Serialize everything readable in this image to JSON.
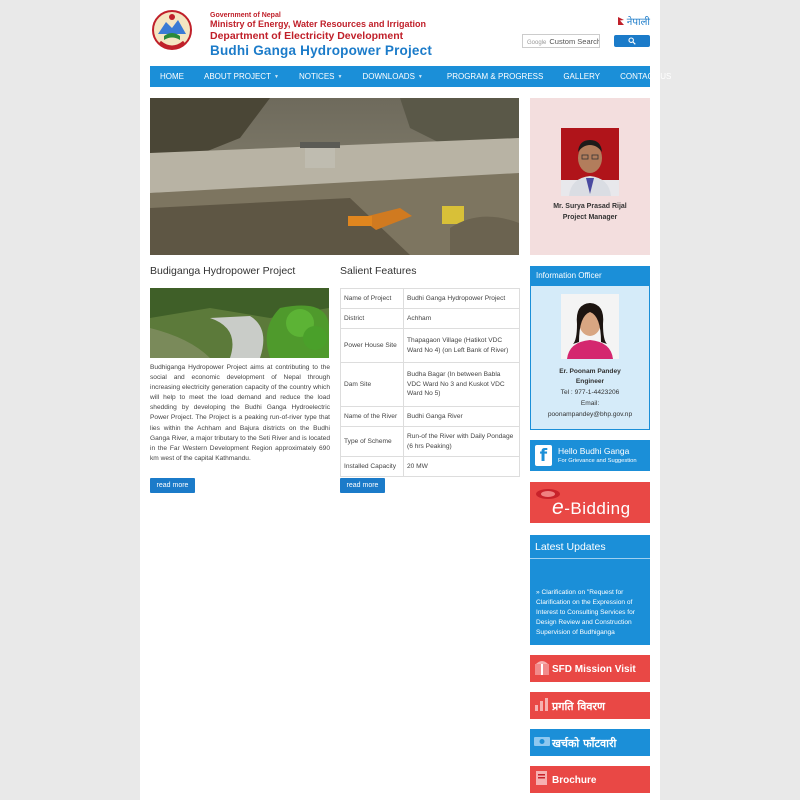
{
  "header": {
    "gov": "Government of Nepal",
    "ministry": "Ministry of Energy, Water Resources and Irrigation",
    "department": "Department of Electricity Development",
    "project": "Budhi Ganga Hydropower Project",
    "language": "नेपाली",
    "search_brand": "Google",
    "search_placeholder": "Custom Search"
  },
  "nav": [
    {
      "label": "HOME",
      "caret": ""
    },
    {
      "label": "ABOUT PROJECT",
      "caret": "▼"
    },
    {
      "label": "NOTICES",
      "caret": "▼"
    },
    {
      "label": "DOWNLOADS",
      "caret": "▼"
    },
    {
      "label": "PROGRAM & PROGRESS",
      "caret": ""
    },
    {
      "label": "GALLERY",
      "caret": ""
    },
    {
      "label": "CONTACT US",
      "caret": ""
    }
  ],
  "manager": {
    "name": "Mr. Surya Prasad Rijal",
    "title": "Project Manager"
  },
  "project": {
    "title": "Budiganga Hydropower Project",
    "description": "Budhiganga Hydropower Project aims at contributing to the social and economic development of Nepal through increasing electricity generation capacity of the country which will help to meet the load demand and reduce the load shedding by developing the Budhi Ganga Hydroelectric Power Project. The Project is a peaking run-of-river type that lies within the Achham and Bajura districts on the Budhi Ganga River, a major tributary to the Seti River and is located in the Far Western Development Region approximately 690 km west of the capital Kathmandu.",
    "read_more": "read more"
  },
  "features": {
    "title": "Salient Features",
    "rows": [
      {
        "label": "Name of Project",
        "value": "Budhi Ganga Hydropower Project"
      },
      {
        "label": "District",
        "value": "Achham"
      },
      {
        "label": "Power House Site",
        "value": "Thapagaon Village (Hatikot VDC Ward No 4) (on Left Bank of River)"
      },
      {
        "label": "Dam Site",
        "value": "Budha Bagar (In between Babla VDC Ward No 3 and Kuskot VDC Ward No 5)"
      },
      {
        "label": "Name of the River",
        "value": "Budhi Ganga River"
      },
      {
        "label": "Type of Scheme",
        "value": "Run-of the River with Daily Pondage (6 hrs Peaking)"
      },
      {
        "label": "Installed Capacity",
        "value": "20 MW"
      }
    ],
    "read_more": "read more"
  },
  "info_officer": {
    "heading": "Information Officer",
    "name": "Er. Poonam Pandey",
    "role": "Engineer",
    "tel": "Tel : 977-1-4423206",
    "email_label": "Email:",
    "email": "poonampandey@bhp.gov.np"
  },
  "facebook": {
    "title": "Hello Budhi Ganga",
    "subtitle": "For Grievance and Suggestion"
  },
  "ebidding": {
    "prefix": "e",
    "label": "-Bidding"
  },
  "updates": {
    "heading": "Latest Updates",
    "item": "» Clarification on \"Request for Clarification on the Expression of Interest to Consulting Services for Design Review and Construction Supervision of Budhiganga"
  },
  "banners": {
    "sfd": "SFD Mission Visit",
    "progress": "प्रगति विवरण",
    "expense": "खर्चको फाँटवारी",
    "brochure": "Brochure"
  },
  "colors": {
    "accent": "#1b8fd8",
    "red": "#c0202a",
    "banner_red": "#e94845"
  }
}
